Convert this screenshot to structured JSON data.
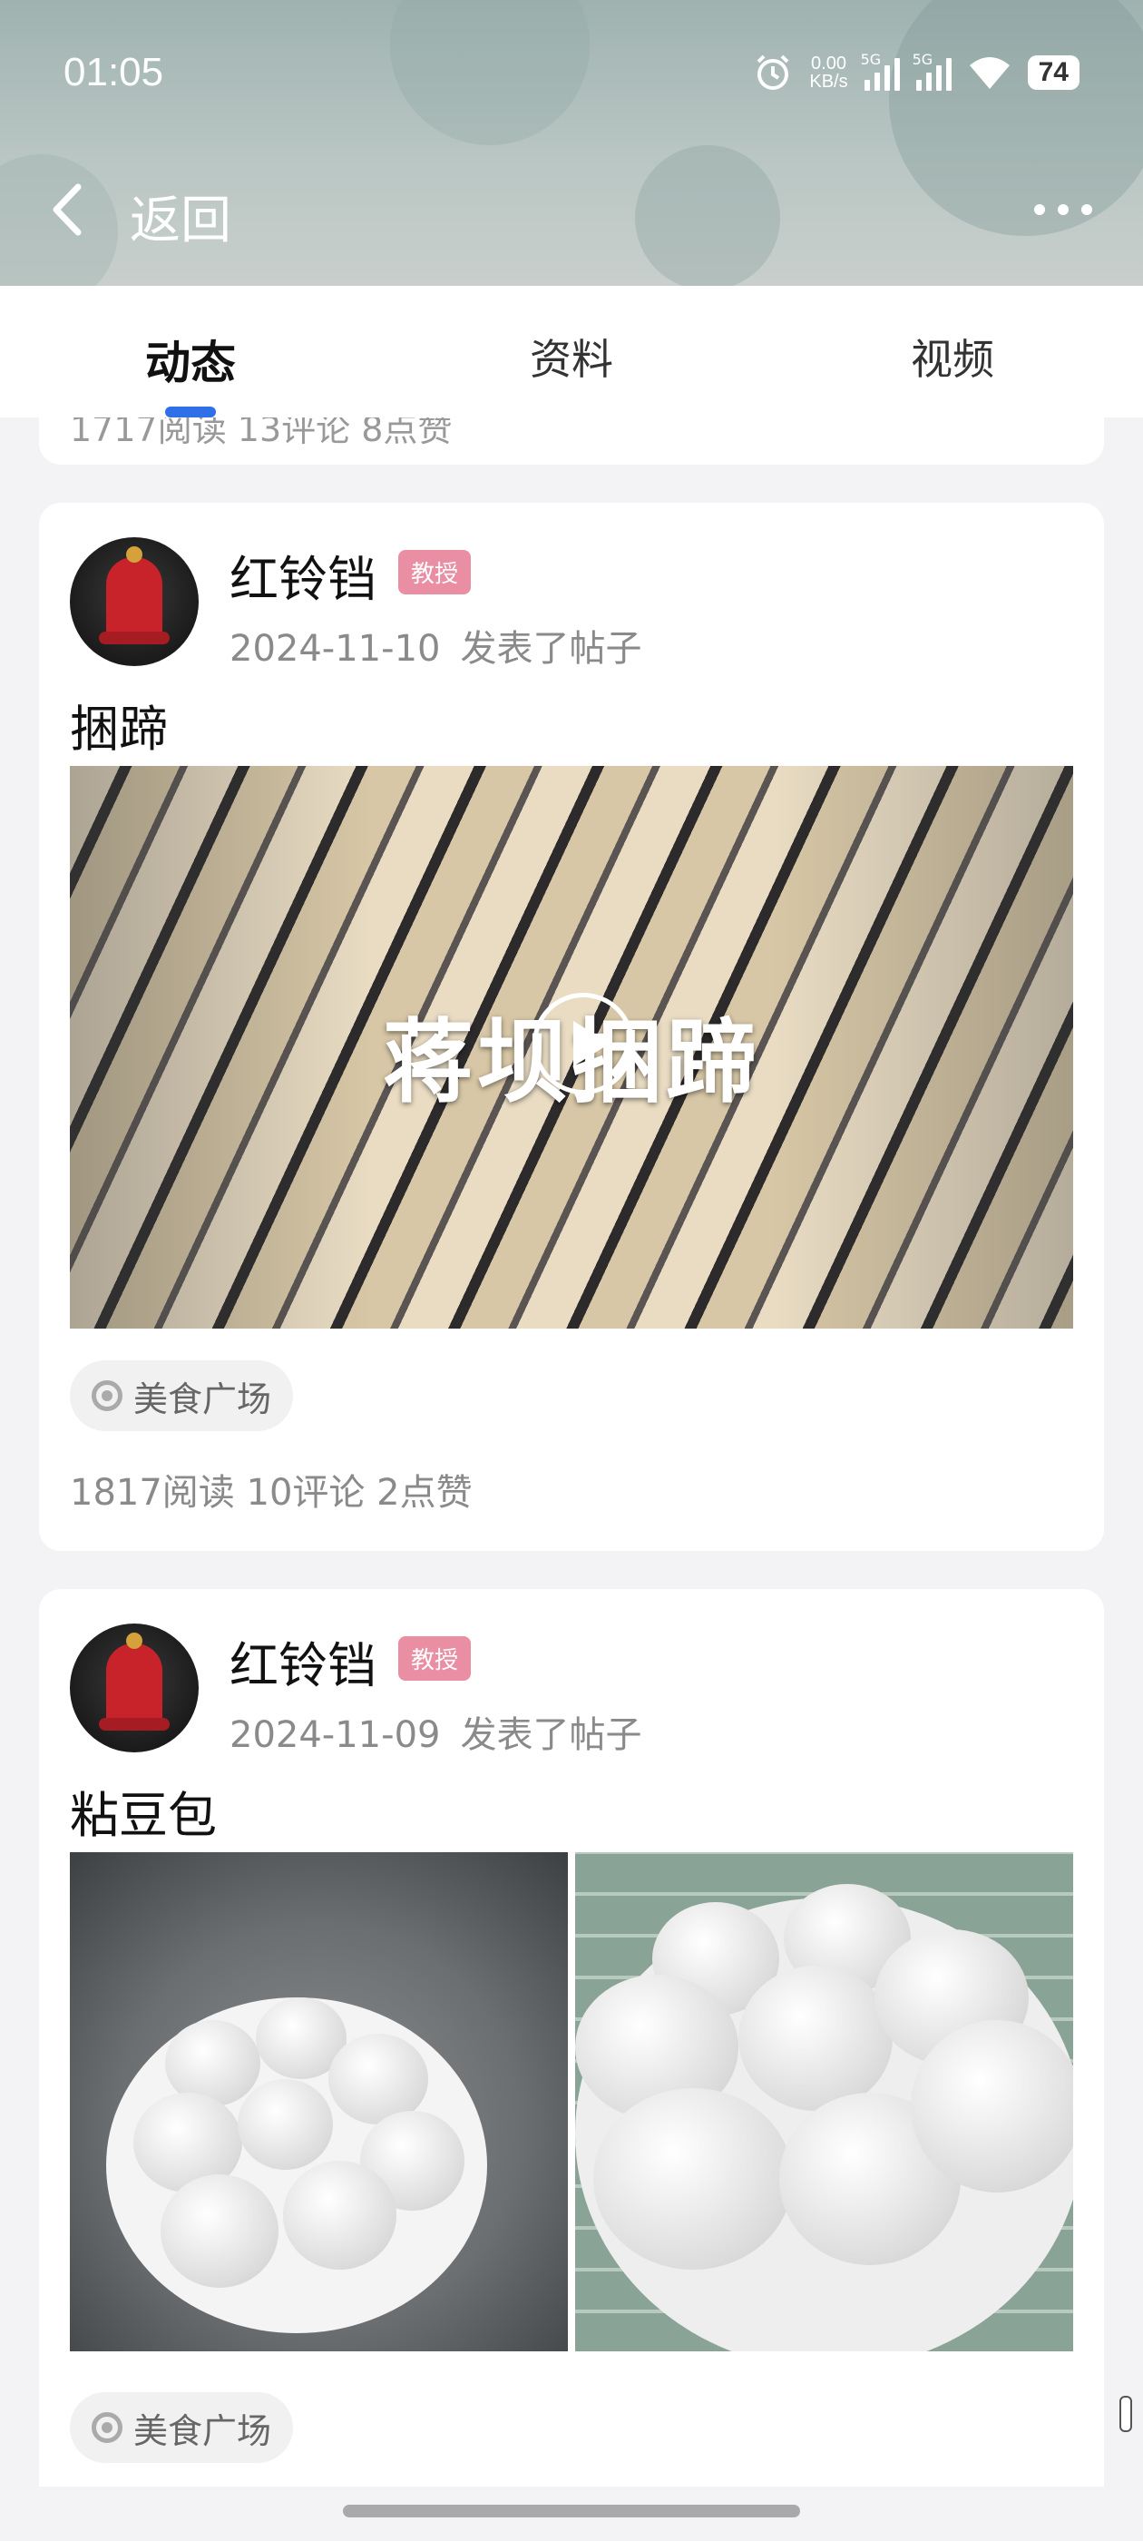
{
  "status_bar": {
    "time": "01:05",
    "net_speed_value": "0.00",
    "net_speed_unit": "KB/s",
    "sim1": "5G",
    "sim2": "5G",
    "battery": "74"
  },
  "nav": {
    "back_label": "返回"
  },
  "tabs": [
    {
      "label": "动态",
      "active": true
    },
    {
      "label": "资料",
      "active": false
    },
    {
      "label": "视频",
      "active": false
    }
  ],
  "partial_card": {
    "stats": "1717阅读 13评论 8点赞"
  },
  "posts": [
    {
      "author": "红铃铛",
      "badge": "教授",
      "date": "2024-11-10",
      "action": "发表了帖子",
      "title": "捆蹄",
      "media_type": "video",
      "video_caption": "蒋坝捆蹄",
      "topic": "美食广场",
      "stats": "1817阅读 10评论 2点赞"
    },
    {
      "author": "红铃铛",
      "badge": "教授",
      "date": "2024-11-09",
      "action": "发表了帖子",
      "title": "粘豆包",
      "media_type": "photos",
      "topic": "美食广场"
    }
  ],
  "colors": {
    "tab_indicator": "#2f6fe8",
    "badge": "#e98ea3",
    "page_bg": "#f3f3f5"
  }
}
